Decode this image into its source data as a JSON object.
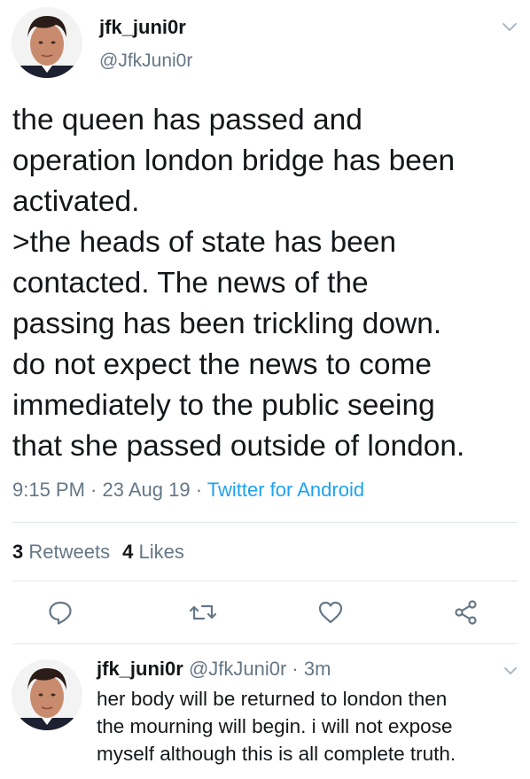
{
  "tweet": {
    "author_name": "jfk_juni0r",
    "author_handle": "@JfkJuni0r",
    "body_lines": [
      "the queen has passed and",
      "operation london bridge has been",
      "activated.",
      ">the heads of state has been",
      "contacted. The news of the",
      "passing has been trickling down.",
      "do not expect the news to come",
      "immediately to the public seeing",
      "that she passed outside of london."
    ],
    "time": "9:15 PM",
    "separator": " · ",
    "date": "23 Aug 19",
    "source": "Twitter for Android",
    "retweets_count": "3",
    "retweets_label": "Retweets",
    "likes_count": "4",
    "likes_label": "Likes",
    "icons": [
      "reply-icon",
      "retweet-icon",
      "like-icon",
      "share-icon",
      "chevron-down-icon"
    ]
  },
  "reply": {
    "author_name": "jfk_juni0r",
    "author_handle": "@JfkJuni0r",
    "separator": " · ",
    "time": "3m",
    "body_lines": [
      "her body will be returned to london then",
      "the mourning will begin. i will not expose",
      "myself although this is all complete truth."
    ]
  },
  "colors": {
    "text": "#14171a",
    "secondary": "#657786",
    "link": "#1da1f2",
    "divider": "#e1e8ed"
  }
}
